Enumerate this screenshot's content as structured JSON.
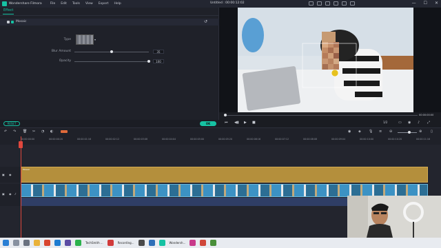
{
  "titlebar": {
    "app_name": "Wondershare Filmora",
    "menu": [
      "File",
      "Edit",
      "Tools",
      "View",
      "Export",
      "Help"
    ],
    "window_title": "Untitled : 00:00:12:02",
    "controls": [
      "—",
      "☐",
      "✕"
    ]
  },
  "effect": {
    "tab": "Effect",
    "section": "Mosaic",
    "type_label": "Type",
    "blur_label": "Blur Amount",
    "blur_value": "35",
    "blur_fraction": 0.5,
    "opacity_label": "Opacity",
    "opacity_value": "100",
    "opacity_fraction": 1.0,
    "reset": "RESET",
    "ok": "OK"
  },
  "preview": {
    "time": "00:00:00:00",
    "ratio": "1/2"
  },
  "ruler": {
    "ticks": [
      "00:00:00:00",
      "00:00:00:20",
      "00:00:01:16",
      "00:00:02:12",
      "00:00:03:08",
      "00:00:04:04",
      "00:00:05:00",
      "00:00:05:20",
      "00:00:06:16",
      "00:00:07:12",
      "00:00:08:08",
      "00:00:09:04",
      "00:00:10:00",
      "00:00:10:20",
      "00:00:11:16"
    ]
  },
  "timeline": {
    "audio_clip_label": "Mosaic"
  },
  "taskbar": {
    "labels": [
      "TechSmith ...",
      "Recording...",
      "Wondersh..."
    ]
  },
  "colors": {
    "accent": "#16c2a3",
    "playhead": "#e0473d"
  }
}
